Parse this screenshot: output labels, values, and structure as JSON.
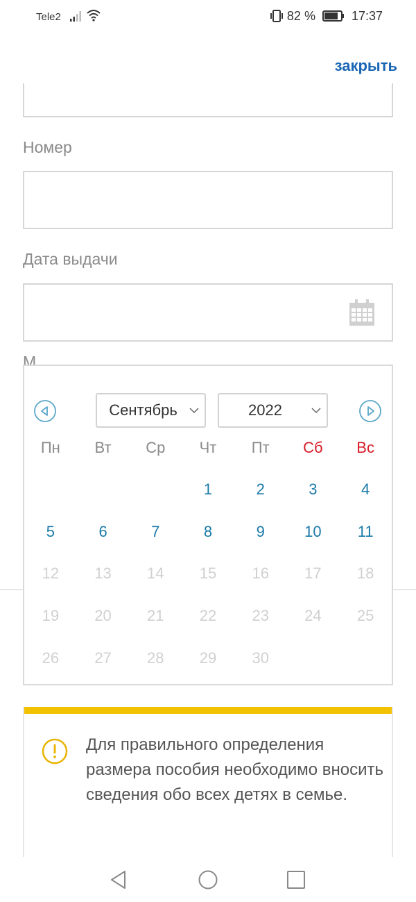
{
  "status_bar": {
    "carrier": "Tele2",
    "battery": "82 %",
    "time": "17:37"
  },
  "close_label": "закрыть",
  "form": {
    "number_label": "Номер",
    "issue_date_label": "Дата выдачи",
    "hidden_label_fragment": "М"
  },
  "datepicker": {
    "month": "Сентябрь",
    "year": "2022",
    "weekdays": [
      "Пн",
      "Вт",
      "Ср",
      "Чт",
      "Пт",
      "Сб",
      "Вс"
    ],
    "days": [
      [
        "",
        "",
        "",
        "1",
        "2",
        "3",
        "4"
      ],
      [
        "5",
        "6",
        "7",
        "8",
        "9",
        "10",
        "11"
      ],
      [
        "12",
        "13",
        "14",
        "15",
        "16",
        "17",
        "18"
      ],
      [
        "19",
        "20",
        "21",
        "22",
        "23",
        "24",
        "25"
      ],
      [
        "26",
        "27",
        "28",
        "29",
        "30",
        "",
        ""
      ]
    ],
    "last_enabled_day": 11
  },
  "info": {
    "text": "Для правильного определения размера пособия необходимо вносить сведения обо всех детях в семье."
  },
  "colors": {
    "accent": "#1a66b5",
    "day_active": "#1a7aa8",
    "weekend": "#d71e27",
    "warning": "#f2c200"
  }
}
